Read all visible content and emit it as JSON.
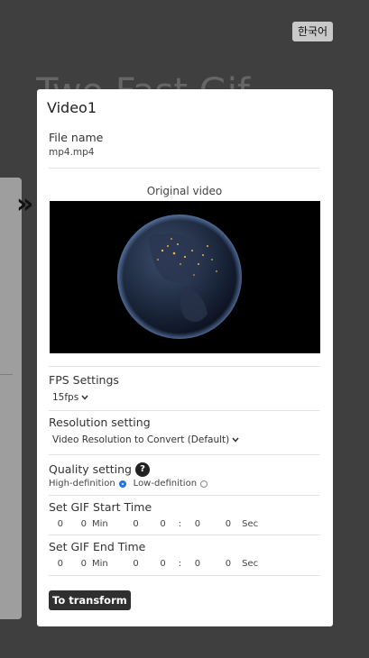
{
  "lang_button": "한국어",
  "background_title": "Two Fast Gif",
  "modal": {
    "title": "Video1",
    "file_name_label": "File name",
    "file_name_value": "mp4.mp4",
    "original_video_label": "Original video",
    "fps": {
      "label": "FPS Settings",
      "value": "15fps"
    },
    "resolution": {
      "label": "Resolution setting",
      "value": "Video Resolution to Convert (Default)"
    },
    "quality": {
      "label": "Quality setting",
      "help": "?",
      "options": [
        "High-definition",
        "Low-definition"
      ],
      "selected": "High-definition"
    },
    "start_time": {
      "label": "Set GIF Start Time",
      "min_a": "0",
      "min_b": "0",
      "min_unit": "Min",
      "sec_a": "0",
      "sec_b": "0",
      "sep": ":",
      "sec_c": "0",
      "sec_d": "0",
      "sec_unit": "Sec"
    },
    "end_time": {
      "label": "Set GIF End Time",
      "min_a": "0",
      "min_b": "0",
      "min_unit": "Min",
      "sec_a": "0",
      "sec_b": "0",
      "sep": ":",
      "sec_c": "0",
      "sec_d": "0",
      "sec_unit": "Sec"
    },
    "transform_button": "To transform"
  },
  "colors": {
    "overlay": "#3f3f3f",
    "accent_radio": "#1a73e8",
    "button_bg": "#2f2f2f"
  }
}
